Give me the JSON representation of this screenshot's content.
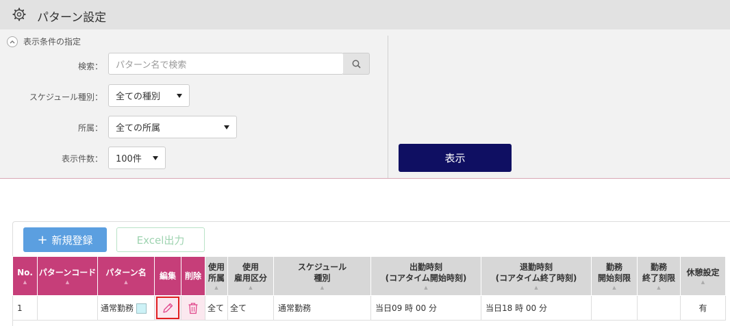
{
  "header": {
    "title": "パターン設定"
  },
  "filter": {
    "section_label": "表示条件の指定",
    "search_label": "検索：",
    "search_placeholder": "パターン名で検索",
    "schedule_label": "スケジュール種別：",
    "schedule_value": "全ての種別",
    "dept_label": "所属：",
    "dept_value": "全ての所属",
    "count_label": "表示件数：",
    "count_value": "100件",
    "show_button": "表示"
  },
  "actions": {
    "new_label": "新規登録",
    "excel_label": "Excel出力"
  },
  "colors": {
    "accent": "#c63e79",
    "primary": "#0f0f62",
    "new_button": "#5b9fe0"
  },
  "table": {
    "headers": {
      "no": "No.",
      "code": "パターンコード",
      "name": "パターン名",
      "edit": "編集",
      "del": "削除",
      "use_dept_1": "使用",
      "use_dept_2": "所属",
      "use_emp_1": "使用",
      "use_emp_2": "雇用区分",
      "sched_1": "スケジュール",
      "sched_2": "種別",
      "in_1": "出勤時刻",
      "in_2": "(コアタイム開始時刻)",
      "out_1": "退勤時刻",
      "out_2": "(コアタイム終了時刻)",
      "start_1": "勤務",
      "start_2": "開始刻限",
      "end_1": "勤務",
      "end_2": "終了刻限",
      "rest": "休憩設定"
    },
    "rows": [
      {
        "no": "1",
        "code": "",
        "name": "通常勤務",
        "dept": "全て",
        "emp": "全て",
        "sched": "通常勤務",
        "in_time": "当日09 時 00 分",
        "out_time": "当日18 時 00 分",
        "start_limit": "",
        "end_limit": "",
        "rest": "有"
      }
    ]
  }
}
